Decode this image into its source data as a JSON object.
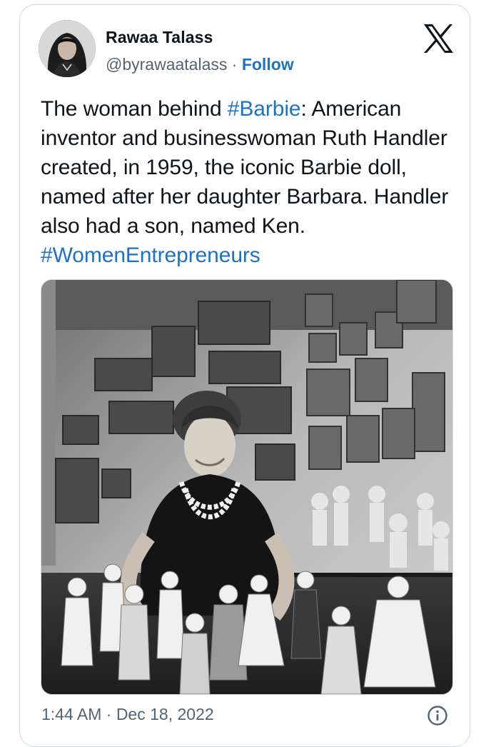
{
  "author": {
    "name": "Rawaa Talass",
    "handle": "@byrawaatalass",
    "separator": " · ",
    "follow_label": "Follow"
  },
  "logo": {
    "icon": "x-logo-icon"
  },
  "tweet": {
    "segments": [
      {
        "text": "The woman behind ",
        "type": "text"
      },
      {
        "text": "#Barbie",
        "type": "hashtag"
      },
      {
        "text": ": American inventor and businesswoman Ruth Handler created, in 1959, the iconic Barbie doll, named after her daughter Barbara. Handler also had a son, named Ken. ",
        "type": "text"
      },
      {
        "text": "#WomenEntrepreneurs",
        "type": "hashtag"
      }
    ]
  },
  "footer": {
    "timestamp": "1:44 AM · Dec 18, 2022",
    "info_icon": "info-icon"
  },
  "colors": {
    "link": "#1d72c4",
    "text": "#0f1419",
    "secondary": "#536471",
    "border": "#cfd9de"
  }
}
